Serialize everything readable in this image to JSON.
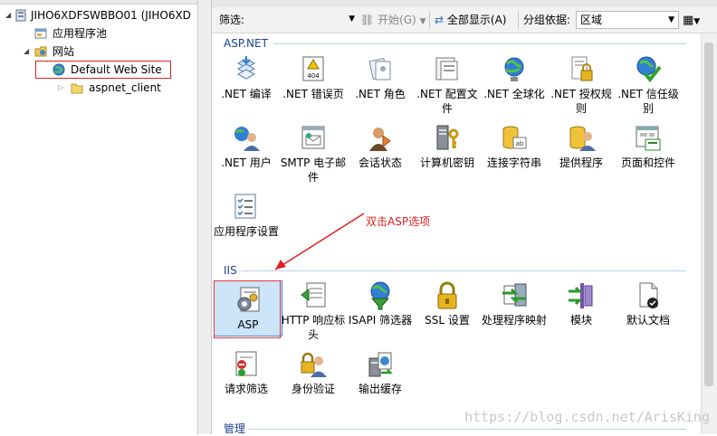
{
  "tree": {
    "server": "JIHO6XDFSWBBO01 (JIHO6XD",
    "app_pools": "应用程序池",
    "sites": "网站",
    "default_site": "Default Web Site",
    "child": "aspnet_client"
  },
  "toolbar": {
    "filter_label": "筛选:",
    "start_label": "开始(G)",
    "show_all_label": "全部显示(A)",
    "group_by_label": "分组依据:",
    "group_value": "区域"
  },
  "groups": {
    "aspnet": "ASP.NET",
    "iis": "IIS",
    "manage": "管理"
  },
  "aspnet_items": [
    ".NET 编译",
    ".NET 错误页",
    ".NET 角色",
    ".NET 配置文件",
    ".NET 全球化",
    ".NET 授权规则",
    ".NET 信任级别",
    ".NET 用户",
    "SMTP 电子邮件",
    "会话状态",
    "计算机密钥",
    "连接字符串",
    "提供程序",
    "页面和控件",
    "应用程序设置"
  ],
  "iis_items": [
    "ASP",
    "HTTP 响应标头",
    "ISAPI 筛选器",
    "SSL 设置",
    "处理程序映射",
    "模块",
    "默认文档",
    "请求筛选",
    "身份验证",
    "输出缓存"
  ],
  "icons": {
    "error_badge": "404"
  },
  "annotation": "双击ASP选项",
  "watermark": "https://blog.csdn.net/ArisKing"
}
